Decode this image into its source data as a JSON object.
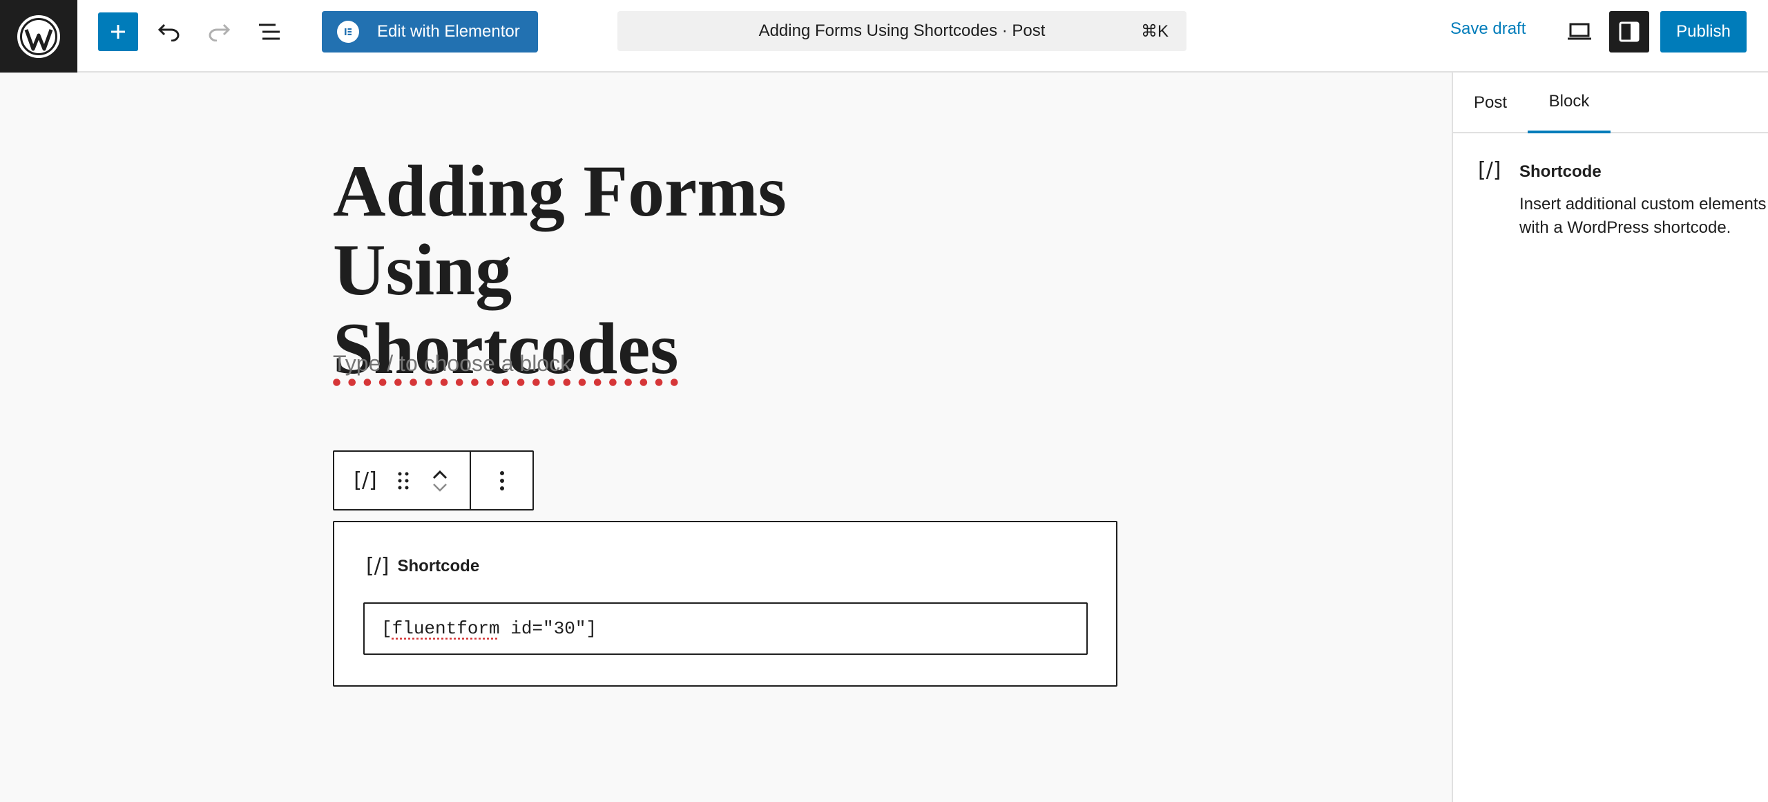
{
  "header": {
    "add_block_label": "+",
    "elementor_button_label": "Edit with Elementor",
    "document_title": "Adding Forms Using Shortcodes · Post",
    "command_shortcut": "⌘K",
    "save_draft_label": "Save draft",
    "publish_label": "Publish",
    "icons": [
      "wordpress-logo",
      "plus-icon",
      "undo-icon",
      "redo-icon",
      "document-overview-icon",
      "elementor-icon",
      "desktop-preview-icon",
      "settings-sidebar-icon"
    ]
  },
  "editor": {
    "title_line1": "Adding Forms Using",
    "title_line2": "Shortcodes",
    "placeholder": "Type / to choose a block",
    "toolbar": {
      "shortcode_icon": "[/]"
    },
    "shortcode_block": {
      "icon": "[/]",
      "label": "Shortcode",
      "value_prefix": "[",
      "value_word": "fluentform",
      "value_suffix": " id=\"30\"]"
    }
  },
  "sidebar": {
    "tabs": [
      {
        "label": "Post",
        "active": false
      },
      {
        "label": "Block",
        "active": true
      }
    ],
    "block_card": {
      "icon": "[/]",
      "title": "Shortcode",
      "description": "Insert additional custom elements with a WordPress shortcode."
    }
  },
  "colors": {
    "accent": "#007cba",
    "elementor": "#2271b1",
    "dark": "#1e1e1e",
    "canvas": "#f9f9f9"
  }
}
